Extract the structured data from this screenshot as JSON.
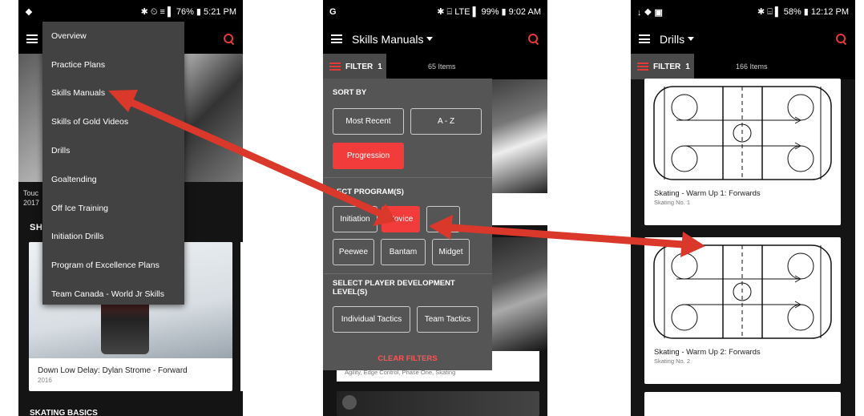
{
  "phone1": {
    "status": {
      "left": "❖",
      "right": "✱ ⏲ ≡ ▌ 76% ▮ 5:21 PM"
    },
    "hero_caption": {
      "title": "Touc",
      "year": "2017"
    },
    "section_title": "SH",
    "card": {
      "title": "Down Low Delay: Dylan Strome - Forward",
      "year": "2016"
    },
    "bottom_section": "SKATING BASICS",
    "menu": [
      "Overview",
      "Practice Plans",
      "Skills Manuals",
      "Skills of Gold Videos",
      "Drills",
      "Goaltending",
      "Off Ice Training",
      "Initiation Drills",
      "Program of Excellence Plans",
      "Team Canada - World Jr Skills"
    ]
  },
  "phone2": {
    "status": {
      "left": "G",
      "right": "✱ ⌸ LTE ▌ 99% ▮ 9:02 AM"
    },
    "title": "Skills Manuals",
    "filter_label": "FILTER",
    "filter_count": "1",
    "items_count": "65 Items",
    "sort_by": "SORT BY",
    "sort_options": [
      "Most Recent",
      "A - Z",
      "Progression"
    ],
    "program_title": "ECT PROGRAM(S)",
    "programs": [
      "Initiation",
      "Novice",
      "",
      "Peewee",
      "Bantam",
      "Midget"
    ],
    "player_level_title": "SELECT PLAYER DEVELOPMENT LEVEL(S)",
    "levels": [
      "Individual Tactics",
      "Team Tactics"
    ],
    "clear_filters": "CLEAR FILTERS",
    "bg_card_tags": "Agility, Edge Control, Phase One, Skating"
  },
  "phone3": {
    "status": {
      "left": "↓ ❖ ▣",
      "right": "✱ ⌸ ▌ 58% ▮ 12:12 PM"
    },
    "title": "Drills",
    "filter_label": "FILTER",
    "filter_count": "1",
    "items_count": "166 Items",
    "drills": [
      {
        "title": "Skating - Warm Up 1: Forwards",
        "sub": "Skating No. 1"
      },
      {
        "title": "Skating - Warm Up 2: Forwards",
        "sub": "Skating No. 2"
      }
    ]
  },
  "colors": {
    "accent": "#f23c3c",
    "arrow": "#d9382b",
    "panel": "#555555",
    "menu": "#424242"
  }
}
